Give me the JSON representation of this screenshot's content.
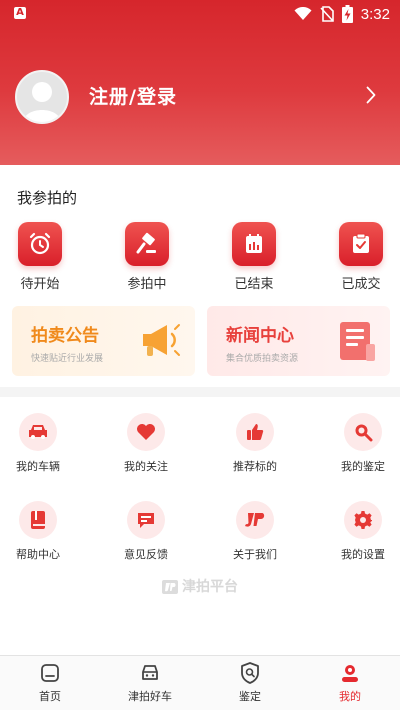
{
  "status_bar": {
    "time": "3:32",
    "app_icon": "A",
    "icons": [
      "wifi-icon",
      "no-sim-icon",
      "battery-charging-icon"
    ]
  },
  "profile": {
    "login_label": "注册/登录",
    "avatar_icon": "user-avatar-icon",
    "chevron_icon": "chevron-right-icon"
  },
  "my_bids": {
    "title": "我参拍的",
    "items": [
      {
        "label": "待开始",
        "icon": "alarm-clock-icon"
      },
      {
        "label": "参拍中",
        "icon": "gavel-icon"
      },
      {
        "label": "已结束",
        "icon": "calendar-icon"
      },
      {
        "label": "已成交",
        "icon": "check-clipboard-icon"
      }
    ]
  },
  "promos": [
    {
      "title": "拍卖公告",
      "subtitle": "快速贴近行业发展",
      "icon": "megaphone-icon",
      "color": "#f08a1c"
    },
    {
      "title": "新闻中心",
      "subtitle": "集合优质拍卖资源",
      "icon": "news-document-icon",
      "color": "#e8403c"
    }
  ],
  "services": [
    {
      "label": "我的车辆",
      "icon": "car-icon"
    },
    {
      "label": "我的关注",
      "icon": "heart-icon"
    },
    {
      "label": "推荐标的",
      "icon": "thumbs-up-icon"
    },
    {
      "label": "我的鉴定",
      "icon": "magnifier-icon"
    },
    {
      "label": "帮助中心",
      "icon": "book-icon"
    },
    {
      "label": "意见反馈",
      "icon": "chat-icon"
    },
    {
      "label": "关于我们",
      "icon": "jp-logo-icon"
    },
    {
      "label": "我的设置",
      "icon": "gear-icon"
    }
  ],
  "watermark": "津拍平台",
  "tabbar": {
    "tabs": [
      {
        "label": "首页",
        "icon": "home-icon",
        "active": false
      },
      {
        "label": "津拍好车",
        "icon": "car-front-icon",
        "active": false
      },
      {
        "label": "鉴定",
        "icon": "shield-search-icon",
        "active": false
      },
      {
        "label": "我的",
        "icon": "person-icon",
        "active": true
      }
    ]
  },
  "colors": {
    "brand_red": "#d6262c",
    "active_tab": "#e52a2f",
    "icon_bg": "#fde9e9"
  }
}
